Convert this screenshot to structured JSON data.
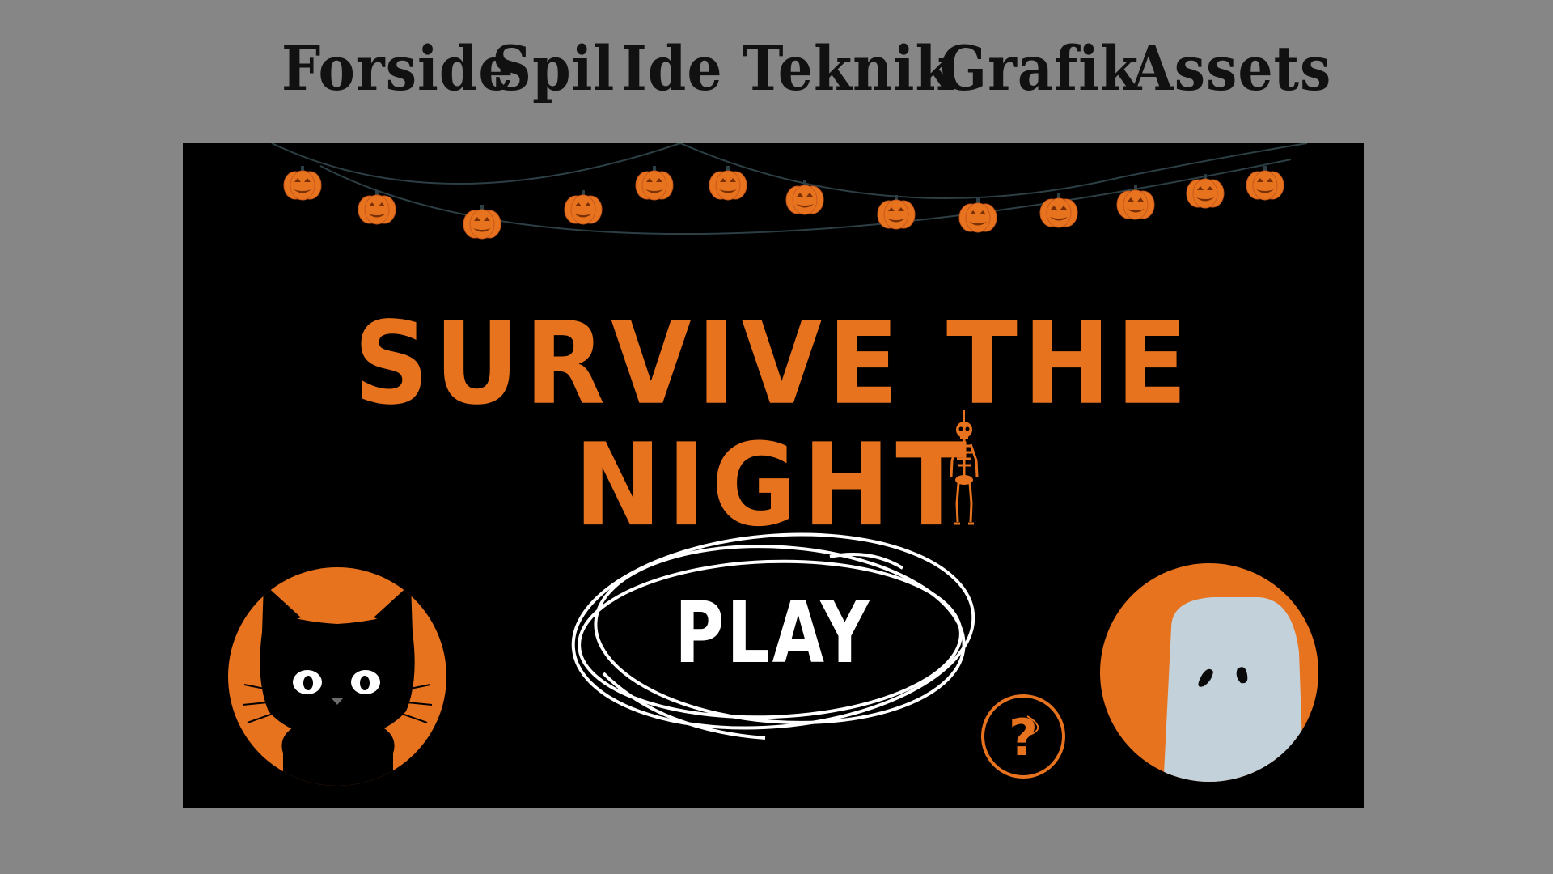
{
  "nav": {
    "items": [
      {
        "label": "Forside"
      },
      {
        "label": "Spil"
      },
      {
        "label": "Ide"
      },
      {
        "label": "Teknik"
      },
      {
        "label": "Grafik"
      },
      {
        "label": "Assets"
      }
    ]
  },
  "game": {
    "title": "SURVIVE THE NIGHT",
    "play_label": "PLAY",
    "help_label": "?"
  },
  "colors": {
    "page_background": "#868686",
    "stage_background": "#000000",
    "accent_orange": "#e8731f",
    "text_white": "#ffffff",
    "nav_text": "#111111",
    "ghost": "#c3d1db",
    "garland_string": "#2c3f45"
  },
  "icons": {
    "garland": "pumpkin-icon",
    "hanging": "skeleton-icon",
    "help": "question-mark-icon",
    "character_left": "black-cat-icon",
    "character_right": "ghost-icon"
  }
}
